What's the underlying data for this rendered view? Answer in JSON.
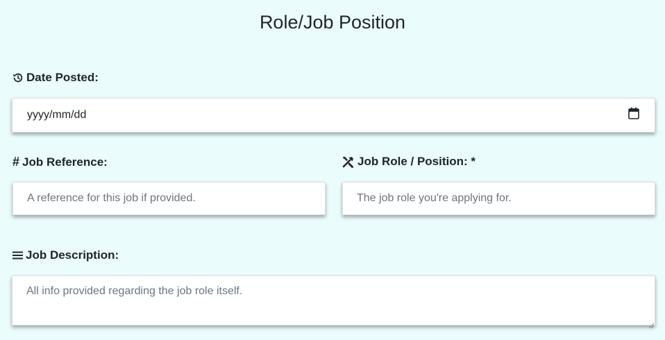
{
  "title": "Role/Job Position",
  "date_posted": {
    "label": "Date Posted:",
    "icon": "history-icon",
    "value": "yyyy/mm/dd",
    "calendar_icon": "calendar-icon"
  },
  "job_reference": {
    "label": "Job Reference:",
    "icon": "hash-icon",
    "icon_glyph": "#",
    "placeholder": "A reference for this job if provided."
  },
  "job_role": {
    "label": "Job Role / Position: *",
    "icon": "tools-icon",
    "placeholder": "The job role you're applying for."
  },
  "job_description": {
    "label": "Job Description:",
    "icon": "list-icon",
    "placeholder": "All info provided regarding the job role itself."
  },
  "colors": {
    "background": "#eafcfc",
    "text": "#212529",
    "placeholder": "#6c757d"
  }
}
